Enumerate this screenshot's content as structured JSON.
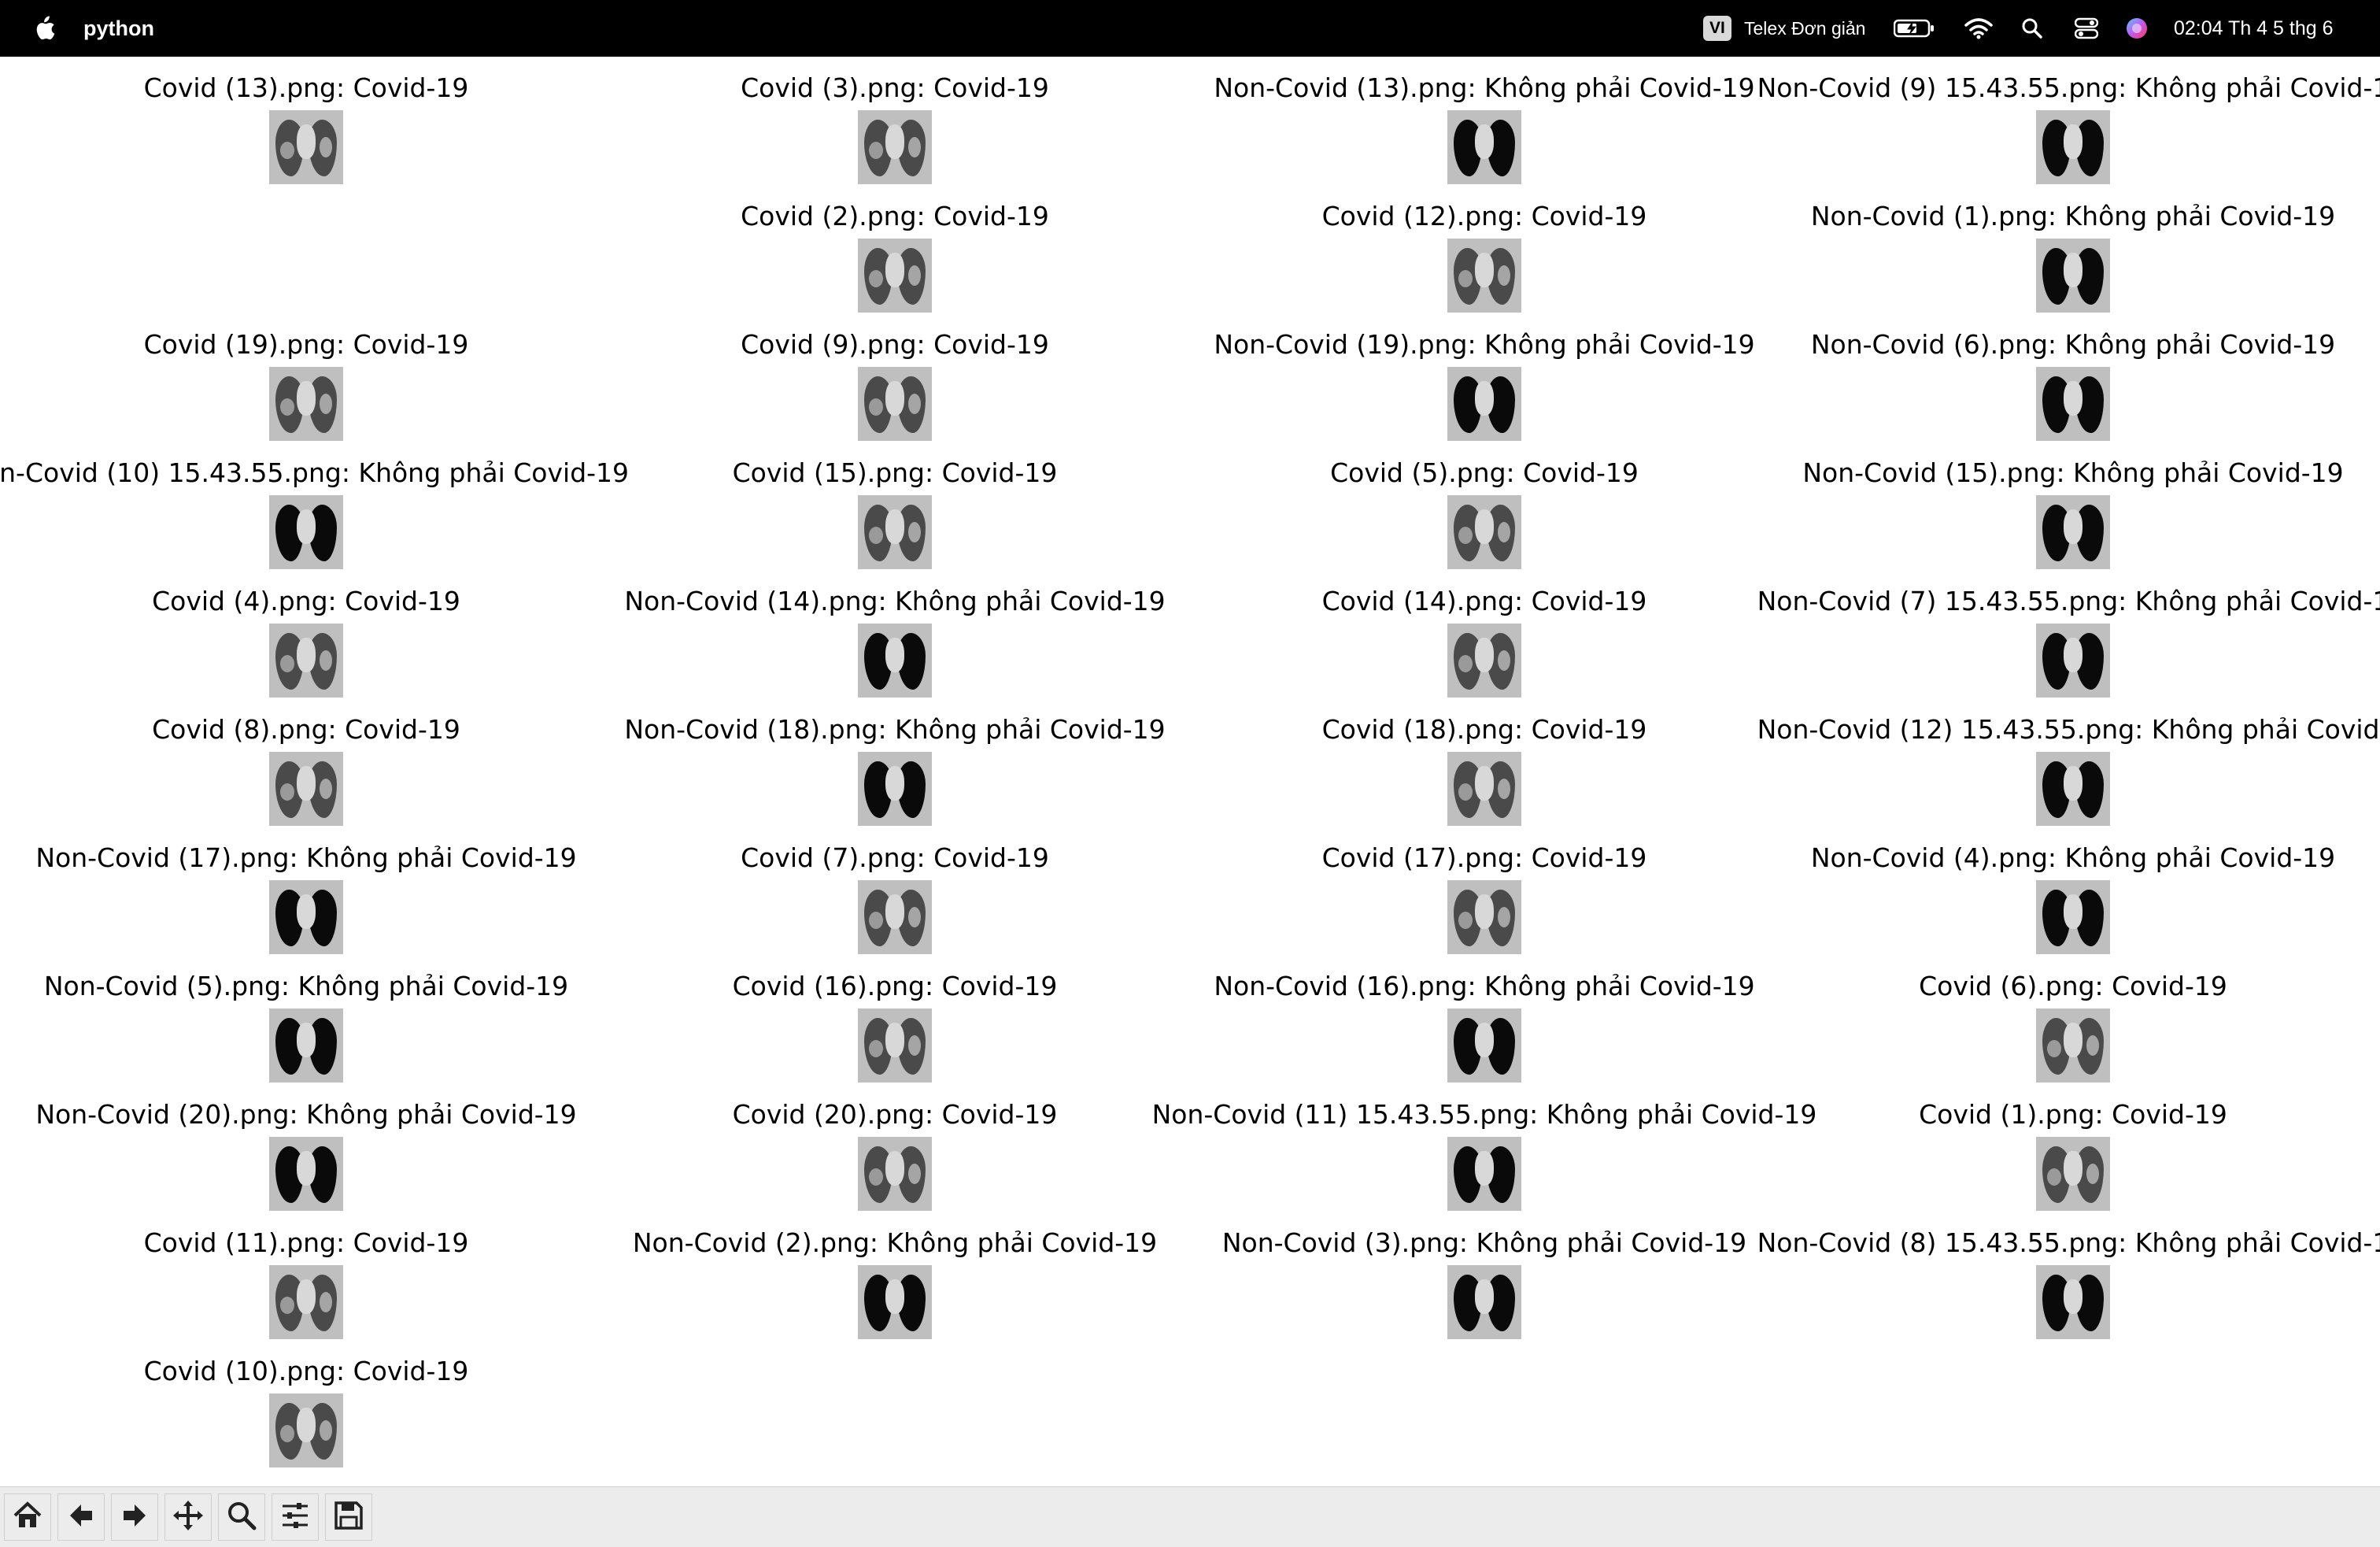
{
  "menubar": {
    "app_name": "python",
    "input_method_badge": "VI",
    "input_method_name": "Telex Đơn giản",
    "clock": "02:04 Th 4 5 thg 6",
    "icons": [
      "apple-icon",
      "battery-icon",
      "wifi-icon",
      "search-icon",
      "control-center-icon",
      "siri-icon"
    ]
  },
  "figure": {
    "columns": [
      [
        {
          "label": "Covid (13).png: Covid-19",
          "covid": true
        },
        {
          "label": "",
          "covid": null
        },
        {
          "label": "Covid (19).png: Covid-19",
          "covid": true
        },
        {
          "label": "on-Covid (10) 15.43.55.png: Không phải Covid-19",
          "covid": false
        },
        {
          "label": "Covid (4).png: Covid-19",
          "covid": true
        },
        {
          "label": "Covid (8).png: Covid-19",
          "covid": true
        },
        {
          "label": "Non-Covid (17).png: Không phải Covid-19",
          "covid": false
        },
        {
          "label": "Non-Covid (5).png: Không phải Covid-19",
          "covid": false
        },
        {
          "label": "Non-Covid (20).png: Không phải Covid-19",
          "covid": false
        },
        {
          "label": "Covid (11).png: Covid-19",
          "covid": true
        },
        {
          "label": "Covid (10).png: Covid-19",
          "covid": true
        }
      ],
      [
        {
          "label": "Covid (3).png: Covid-19",
          "covid": true
        },
        {
          "label": "Covid (2).png: Covid-19",
          "covid": true
        },
        {
          "label": "Covid (9).png: Covid-19",
          "covid": true
        },
        {
          "label": "Covid (15).png: Covid-19",
          "covid": true
        },
        {
          "label": "Non-Covid (14).png: Không phải Covid-19",
          "covid": false
        },
        {
          "label": "Non-Covid (18).png: Không phải Covid-19",
          "covid": false
        },
        {
          "label": "Covid (7).png: Covid-19",
          "covid": true
        },
        {
          "label": "Covid (16).png: Covid-19",
          "covid": true
        },
        {
          "label": "Covid (20).png: Covid-19",
          "covid": true
        },
        {
          "label": "Non-Covid (2).png: Không phải Covid-19",
          "covid": false
        }
      ],
      [
        {
          "label": "Non-Covid (13).png: Không phải Covid-19",
          "covid": false
        },
        {
          "label": "Covid (12).png: Covid-19",
          "covid": true
        },
        {
          "label": "Non-Covid (19).png: Không phải Covid-19",
          "covid": false
        },
        {
          "label": "Covid (5).png: Covid-19",
          "covid": true
        },
        {
          "label": "Covid (14).png: Covid-19",
          "covid": true
        },
        {
          "label": "Covid (18).png: Covid-19",
          "covid": true
        },
        {
          "label": "Covid (17).png: Covid-19",
          "covid": true
        },
        {
          "label": "Non-Covid (16).png: Không phải Covid-19",
          "covid": false
        },
        {
          "label": "Non-Covid (11) 15.43.55.png: Không phải Covid-19",
          "covid": false
        },
        {
          "label": "Non-Covid (3).png: Không phải Covid-19",
          "covid": false
        }
      ],
      [
        {
          "label": "Non-Covid (9) 15.43.55.png: Không phải Covid-1",
          "covid": false
        },
        {
          "label": "Non-Covid (1).png: Không phải Covid-19",
          "covid": false
        },
        {
          "label": "Non-Covid (6).png: Không phải Covid-19",
          "covid": false
        },
        {
          "label": "Non-Covid (15).png: Không phải Covid-19",
          "covid": false
        },
        {
          "label": "Non-Covid (7) 15.43.55.png: Không phải Covid-1",
          "covid": false
        },
        {
          "label": "Non-Covid (12) 15.43.55.png: Không phải Covid-",
          "covid": false
        },
        {
          "label": "Non-Covid (4).png: Không phải Covid-19",
          "covid": false
        },
        {
          "label": "Covid (6).png: Covid-19",
          "covid": true
        },
        {
          "label": "Covid (1).png: Covid-19",
          "covid": true
        },
        {
          "label": "Non-Covid (8) 15.43.55.png: Không phải Covid-1",
          "covid": false
        }
      ]
    ]
  },
  "toolbar": {
    "buttons": [
      {
        "name": "home-icon",
        "glyph": "⌂"
      },
      {
        "name": "back-arrow-icon",
        "glyph": "←"
      },
      {
        "name": "forward-arrow-icon",
        "glyph": "→"
      },
      {
        "name": "pan-move-icon",
        "glyph": "✥"
      },
      {
        "name": "zoom-magnifier-icon",
        "glyph": "🔍"
      },
      {
        "name": "configure-subplots-icon",
        "glyph": "☰"
      },
      {
        "name": "save-figure-icon",
        "glyph": "💾"
      }
    ]
  }
}
